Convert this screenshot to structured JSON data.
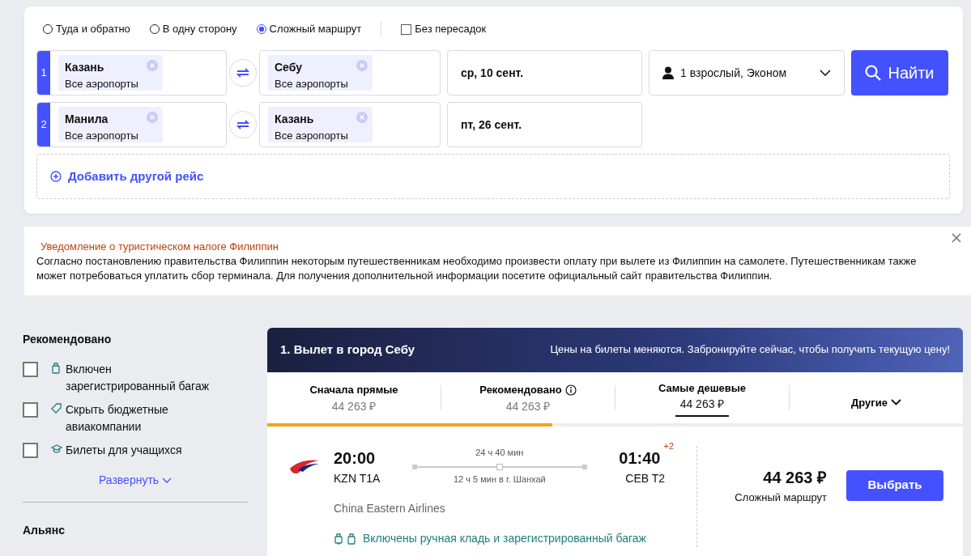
{
  "trip_types": [
    {
      "label": "Туда и обратно",
      "selected": false
    },
    {
      "label": "В одну сторону",
      "selected": false
    },
    {
      "label": "Сложный маршрут",
      "selected": true
    }
  ],
  "nonstop": {
    "label": "Без пересадок",
    "checked": false
  },
  "legs": [
    {
      "number": "1",
      "from": {
        "city": "Казань",
        "airports": "Все аэропорты"
      },
      "to": {
        "city": "Себу",
        "airports": "Все аэропорты"
      },
      "date": "ср, 10 сент."
    },
    {
      "number": "2",
      "from": {
        "city": "Манила",
        "airports": "Все аэропорты"
      },
      "to": {
        "city": "Казань",
        "airports": "Все аэропорты"
      },
      "date": "пт, 26 сент."
    }
  ],
  "passengers": "1 взрослый, Эконом",
  "search_button": "Найти",
  "add_flight": "Добавить другой рейс",
  "notice": {
    "title": "Уведомление о туристическом налоге Филиппин",
    "text": "Согласно постановлению правительства Филиппин некоторым путешественникам необходимо произвести оплату при вылете из Филиппин на самолете. Путешественникам также может потребоваться уплатить сбор терминала. Для получения дополнительной информации посетите официальный сайт правительства Филиппин."
  },
  "filters": {
    "title": "Рекомендовано",
    "items": [
      {
        "kind": "baggage",
        "label": "Включен зарегистрированный багаж",
        "checked": false
      },
      {
        "kind": "tag",
        "label": "Скрыть бюджетные авиакомпании",
        "checked": false
      },
      {
        "kind": "student",
        "label": "Билеты для учащихся",
        "checked": false
      }
    ],
    "expand": "Развернуть",
    "next_title": "Альянс"
  },
  "results": {
    "title": "1. Вылет в город Себу",
    "banner_note": "Цены на билеты меняются. Забронируйте сейчас, чтобы получить текущую цену!",
    "sort_tabs": [
      {
        "label": "Сначала прямые",
        "price": "44 263 ₽",
        "info": false,
        "selected": false
      },
      {
        "label": "Рекомендовано",
        "price": "44 263 ₽",
        "info": true,
        "selected": false
      },
      {
        "label": "Самые дешевые",
        "price": "44 263 ₽",
        "info": false,
        "selected": true
      },
      {
        "label": "Другие",
        "selected": false
      }
    ],
    "progress": {
      "level": 0.41
    },
    "flight": {
      "depart_time": "20:00",
      "depart_airport": "KZN T1A",
      "duration": "24 ч 40 мин",
      "stopover": "12 ч 5 мин в г. Шанхай",
      "arrive_time": "01:40",
      "day_offset": "+2",
      "arrive_airport": "CEB T2",
      "airline": "China Eastern Airlines",
      "baggage": "Включены ручная кладь и зарегистрированный багаж",
      "price": "44 263 ₽",
      "price_note": "Сложный маршрут",
      "select_button": "Выбрать"
    }
  }
}
